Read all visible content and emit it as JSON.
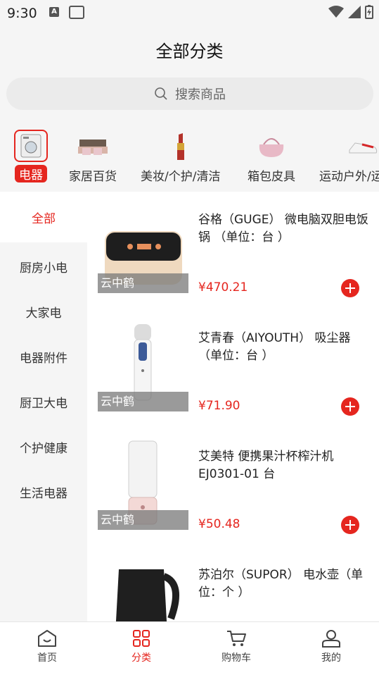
{
  "status_bar": {
    "time": "9:30",
    "a_icon_letter": "A"
  },
  "header": {
    "title": "全部分类"
  },
  "search": {
    "placeholder": "搜索商品"
  },
  "categories": [
    {
      "label": "电器",
      "icon": "washing-machine-icon",
      "selected": true
    },
    {
      "label": "家居百货",
      "icon": "sofa-icon",
      "selected": false
    },
    {
      "label": "美妆/个护/清洁",
      "icon": "lipstick-icon",
      "selected": false
    },
    {
      "label": "箱包皮具",
      "icon": "handbag-icon",
      "selected": false
    },
    {
      "label": "运动户外/运",
      "icon": "sneaker-icon",
      "selected": false
    }
  ],
  "side_nav": [
    {
      "label": "全部",
      "active": true
    },
    {
      "label": "厨房小电",
      "active": false
    },
    {
      "label": "大家电",
      "active": false
    },
    {
      "label": "电器附件",
      "active": false
    },
    {
      "label": "厨卫大电",
      "active": false
    },
    {
      "label": "个护健康",
      "active": false
    },
    {
      "label": "生活电器",
      "active": false
    }
  ],
  "products": [
    {
      "title": "谷格（GUGE） 微电脑双胆电饭锅 （单位：台 ）",
      "price": "¥470.21",
      "badge": "云中鹤",
      "image": "rice-cooker-image"
    },
    {
      "title": "艾青春（AIYOUTH） 吸尘器（单位：台 ）",
      "price": "¥71.90",
      "badge": "云中鹤",
      "image": "vacuum-cleaner-image"
    },
    {
      "title": "艾美特 便携果汁杯榨汁机EJ0301-01 台",
      "price": "¥50.48",
      "badge": "云中鹤",
      "image": "juicer-cup-image"
    },
    {
      "title": "苏泊尔（SUPOR） 电水壶（单位：个 ）",
      "price": "",
      "badge": "",
      "image": "electric-kettle-image"
    }
  ],
  "tabbar": [
    {
      "label": "首页",
      "icon": "home-icon",
      "active": false
    },
    {
      "label": "分类",
      "icon": "category-grid-icon",
      "active": true
    },
    {
      "label": "购物车",
      "icon": "cart-icon",
      "active": false
    },
    {
      "label": "我的",
      "icon": "user-icon",
      "active": false
    }
  ],
  "colors": {
    "accent": "#e5261f",
    "background": "#f5f5f5"
  }
}
